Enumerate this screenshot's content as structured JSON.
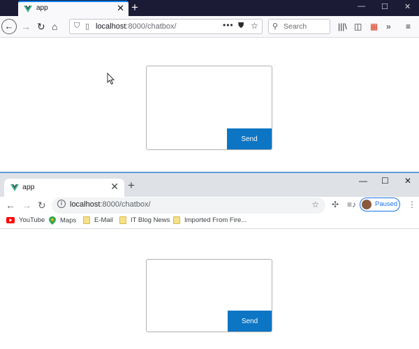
{
  "firefox": {
    "tab_title": "app",
    "tab_close": "✕",
    "new_tab": "+",
    "window_controls": [
      "—",
      "☐",
      "✕"
    ],
    "url_host": "localhost",
    "url_rest": ":8000/chatbox/",
    "search_placeholder": "Search",
    "chat": {
      "message_value": "",
      "send_label": "Send"
    }
  },
  "chrome": {
    "tab_title": "app",
    "tab_close": "✕",
    "new_tab": "+",
    "window_controls": [
      "—",
      "☐",
      "✕"
    ],
    "url_host": "localhost",
    "url_rest": ":8000/chatbox/",
    "profile_label": "Paused",
    "bookmarks": [
      "YouTube",
      "Maps",
      "E-Mail",
      "IT Blog News",
      "Imported From Fire..."
    ],
    "chat": {
      "message_value": "",
      "send_label": "Send"
    }
  },
  "colors": {
    "send_button": "#0c75c4",
    "firefox_titlebar": "#1c1b35",
    "chrome_titlebar": "#dee1e6",
    "chrome_accent": "#1a73e8"
  },
  "icons": {
    "firefox_toolbar": [
      "back-icon",
      "forward-icon",
      "reload-icon",
      "home-icon",
      "shield-icon",
      "page-icon",
      "more-icon",
      "pocket-icon",
      "bookmark-star-icon",
      "search-icon",
      "library-icon",
      "sidebar-icon",
      "extension-icon",
      "overflow-icon",
      "menu-icon"
    ],
    "chrome_toolbar": [
      "back-icon",
      "forward-icon",
      "reload-icon",
      "info-icon",
      "bookmark-star-icon",
      "extensions-icon",
      "media-icon",
      "kebab-menu-icon"
    ]
  }
}
